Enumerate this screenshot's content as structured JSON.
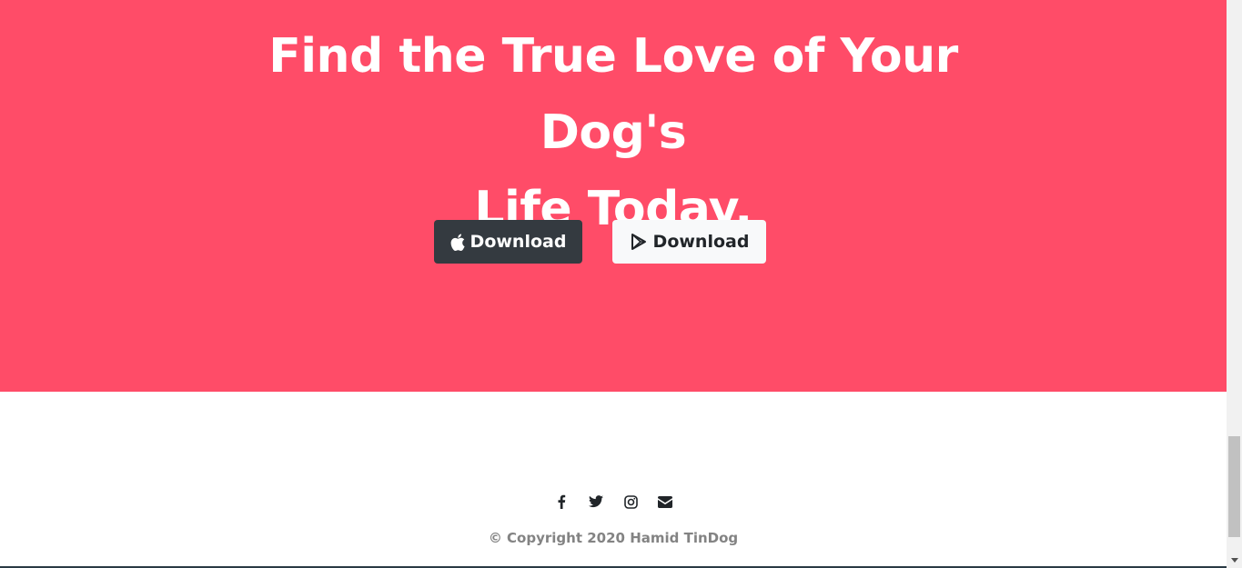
{
  "cta": {
    "title_line1": "Find the True Love of Your Dog's",
    "title_line2": "Life Today.",
    "background": "#ff4c68",
    "buttons": {
      "apple": {
        "label": "Download",
        "icon": "apple-icon",
        "background": "#343a40",
        "color": "#ffffff"
      },
      "play": {
        "label": "Download",
        "icon": "google-play-icon",
        "background": "#f8f9fa",
        "color": "#212529"
      }
    }
  },
  "footer": {
    "social_icons": [
      "facebook-icon",
      "twitter-icon",
      "instagram-icon",
      "envelope-icon"
    ],
    "copyright": "© Copyright 2020 Hamid TinDog",
    "copyright_color": "#838383"
  }
}
